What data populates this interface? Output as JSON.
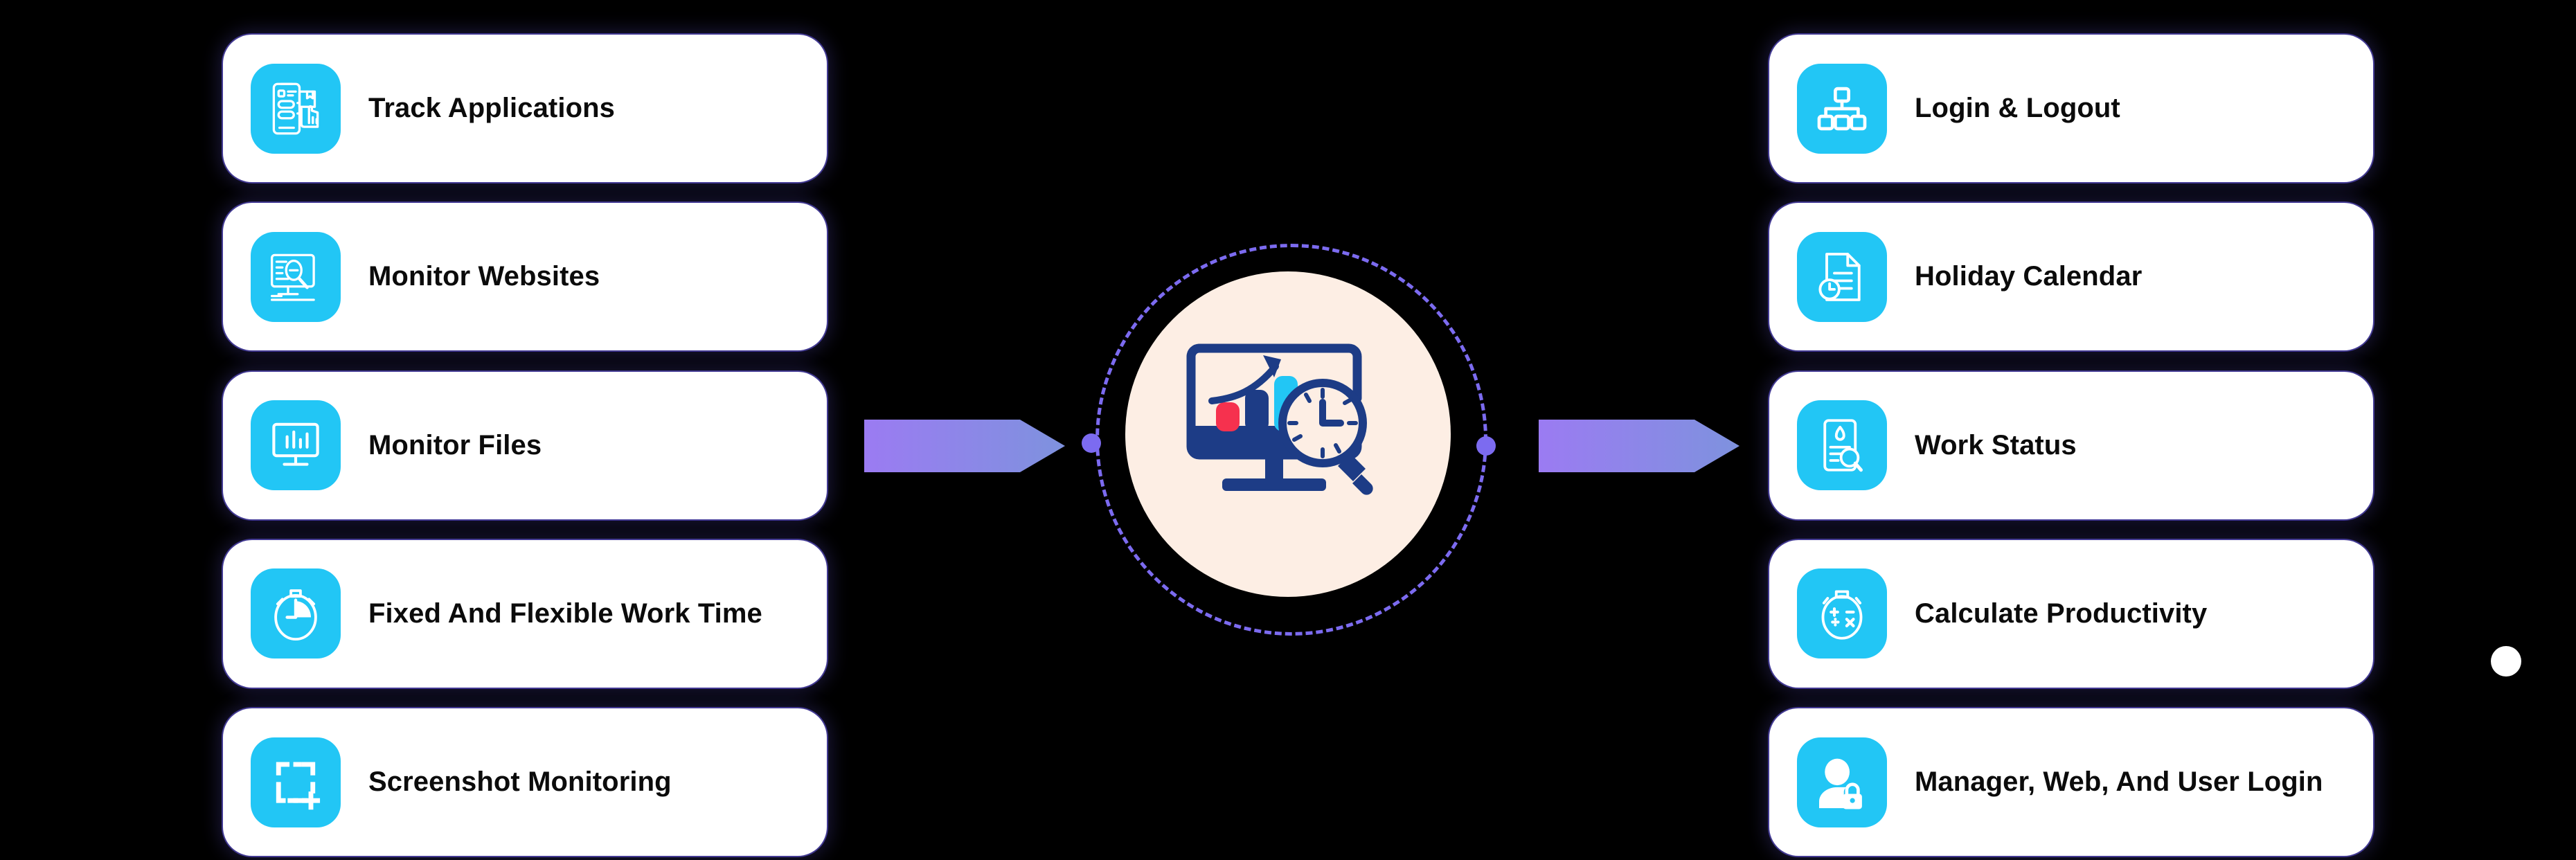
{
  "theme": {
    "background": "#000000",
    "card_background": "#ffffff",
    "card_border_glow": "#6E5FF0",
    "icon_tile": "#22C6F5",
    "label_color": "#0B0B0B",
    "arrow_gradient_start": "#9B7BF2",
    "arrow_gradient_end": "#7E92DE",
    "hub_disc": "#FDEEE4",
    "hub_ring": "#7C6BF0",
    "hub_navy": "#1D3C86",
    "hub_accent_red": "#F6314E",
    "hub_accent_cyan": "#22C6F5",
    "marker_dot": "#FFFFFF"
  },
  "left_column": {
    "items": [
      {
        "label": "Track Applications",
        "icon": "mobile-checklist-hand-icon"
      },
      {
        "label": "Monitor Websites",
        "icon": "monitor-search-icon"
      },
      {
        "label": "Monitor Files",
        "icon": "monitor-bar-chart-icon"
      },
      {
        "label": "Fixed And Flexible Work Time",
        "icon": "stopwatch-icon"
      },
      {
        "label": "Screenshot Monitoring",
        "icon": "screenshot-crop-plus-icon"
      }
    ]
  },
  "right_column": {
    "items": [
      {
        "label": "Login & Logout",
        "icon": "org-hierarchy-icon"
      },
      {
        "label": "Holiday Calendar",
        "icon": "document-clock-icon"
      },
      {
        "label": "Work Status",
        "icon": "document-magnifier-icon"
      },
      {
        "label": "Calculate Productivity",
        "icon": "stopwatch-calculator-icon"
      },
      {
        "label": "Manager, Web, And User Login",
        "icon": "user-lock-icon"
      }
    ]
  },
  "center": {
    "icon": "monitor-analytics-clock-magnifier-icon",
    "ring_style": "dashed-circle",
    "dots": [
      "hub-dot-left",
      "hub-dot-right"
    ]
  },
  "arrows": [
    {
      "name": "arrow-left-to-center",
      "direction": "right"
    },
    {
      "name": "arrow-center-to-right",
      "direction": "right"
    }
  ],
  "marker": {
    "name": "white-dot-marker"
  }
}
